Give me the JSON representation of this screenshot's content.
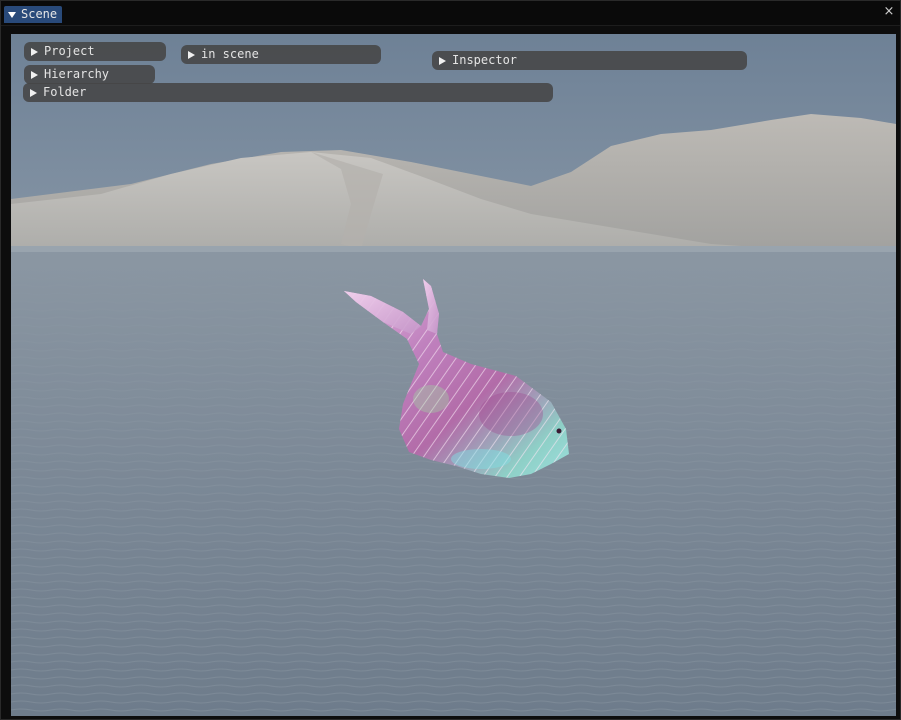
{
  "window": {
    "tab_label": "Scene",
    "close_glyph": "×"
  },
  "panels": {
    "project": "Project",
    "in_scene": "in scene",
    "inspector": "Inspector",
    "hierarchy": "Hierarchy",
    "folder": "Folder"
  },
  "icons": {
    "collapse": "triangle-down-icon",
    "expand": "triangle-right-icon",
    "close": "close-icon"
  },
  "colors": {
    "tab_active": "#294a7a",
    "panel_bg": "#464646",
    "window_bg": "#0d0d0d"
  }
}
